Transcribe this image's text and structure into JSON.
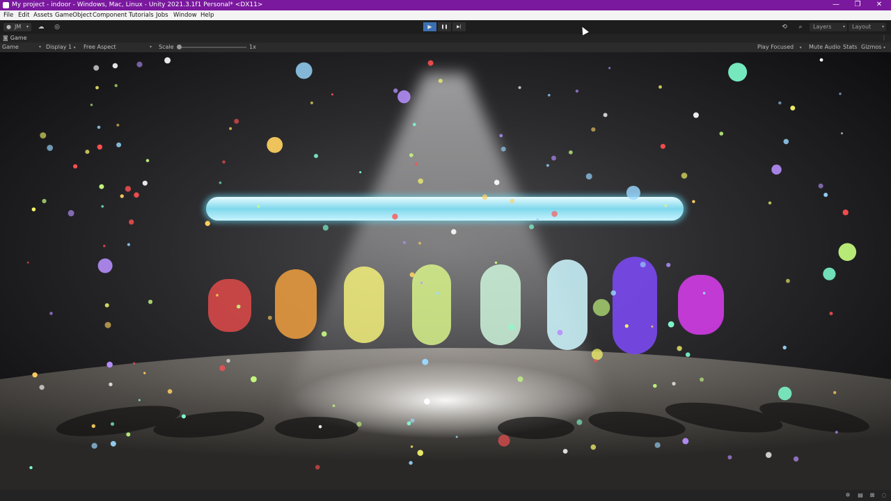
{
  "window": {
    "title": "My project - indoor - Windows, Mac, Linux - Unity 2021.3.1f1 Personal* <DX11>",
    "minimize": "—",
    "restore": "❐",
    "close": "✕"
  },
  "menu": [
    "File",
    "Edit",
    "Assets",
    "GameObject",
    "Component",
    "Tutorials",
    "Jobs",
    "Window",
    "Help"
  ],
  "toolbar": {
    "account": "JM",
    "account_arrow": "▾",
    "cloud_icon": "cloud-icon",
    "collab_icon": "collab-icon",
    "play": "▶",
    "pause": "❚❚",
    "step": "▶|",
    "history_icon": "history-icon",
    "search_icon": "search-icon",
    "layers": "Layers",
    "layout": "Layout",
    "arrow": "▾"
  },
  "tab": {
    "icon": "gamepad-icon",
    "label": "Game",
    "menu": "⋮"
  },
  "gamebar": {
    "mode": "Game",
    "display": "Display 1",
    "aspect": "Free Aspect",
    "scale_label": "Scale",
    "scale_value": "1x",
    "play_focused": "Play Focused",
    "mute_audio": "Mute Audio",
    "stats": "Stats",
    "gizmos": "Gizmos",
    "arrow": "▾"
  },
  "scene": {
    "bar_color": "#9fe6f7",
    "capsules": [
      {
        "name": "red-capsule",
        "color": "#e04a4a"
      },
      {
        "name": "orange-capsule",
        "color": "#f0a040"
      },
      {
        "name": "yellow-capsule",
        "color": "#f2ee7a"
      },
      {
        "name": "lime-capsule",
        "color": "#d8f28a"
      },
      {
        "name": "mint-capsule",
        "color": "#cdf5da"
      },
      {
        "name": "cyan-capsule",
        "color": "#c8f0f6"
      },
      {
        "name": "purple-capsule",
        "color": "#7a48f0"
      },
      {
        "name": "magenta-capsule",
        "color": "#d23ce6"
      }
    ]
  },
  "statusbar": {
    "icons": [
      "bug-icon",
      "layers-icon",
      "stop-icon",
      "circle-check-icon"
    ]
  }
}
